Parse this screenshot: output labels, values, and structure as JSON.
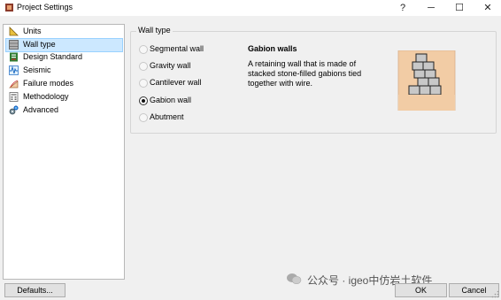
{
  "window": {
    "title": "Project Settings",
    "help_label": "?",
    "minimize_label": "─",
    "maximize_label": "☐",
    "close_label": "✕"
  },
  "sidebar": {
    "items": [
      {
        "label": "Units",
        "icon": "ruler-triangle-icon"
      },
      {
        "label": "Wall type",
        "icon": "wall-type-icon",
        "selected": true
      },
      {
        "label": "Design Standard",
        "icon": "design-standard-icon"
      },
      {
        "label": "Seismic",
        "icon": "seismic-icon"
      },
      {
        "label": "Failure modes",
        "icon": "failure-modes-icon"
      },
      {
        "label": "Methodology",
        "icon": "methodology-icon"
      },
      {
        "label": "Advanced",
        "icon": "advanced-gears-icon"
      }
    ]
  },
  "wall_type": {
    "group_title": "Wall type",
    "options": [
      {
        "label": "Segmental wall",
        "checked": false
      },
      {
        "label": "Gravity wall",
        "checked": false
      },
      {
        "label": "Cantilever wall",
        "checked": false
      },
      {
        "label": "Gabion wall",
        "checked": true
      },
      {
        "label": "Abutment",
        "checked": false
      }
    ],
    "description_title": "Gabion walls",
    "description_text": "A retaining wall that is made of stacked stone-filled gabions tied together with wire."
  },
  "buttons": {
    "defaults": "Defaults...",
    "ok": "OK",
    "cancel": "Cancel"
  },
  "watermark": {
    "text": "公众号 · igeo中仿岩土软件"
  },
  "colors": {
    "selection_bg": "#cce8ff",
    "selection_border": "#99d1ff",
    "soil": "#f2cca5",
    "gabion": "#c8c8c8"
  }
}
